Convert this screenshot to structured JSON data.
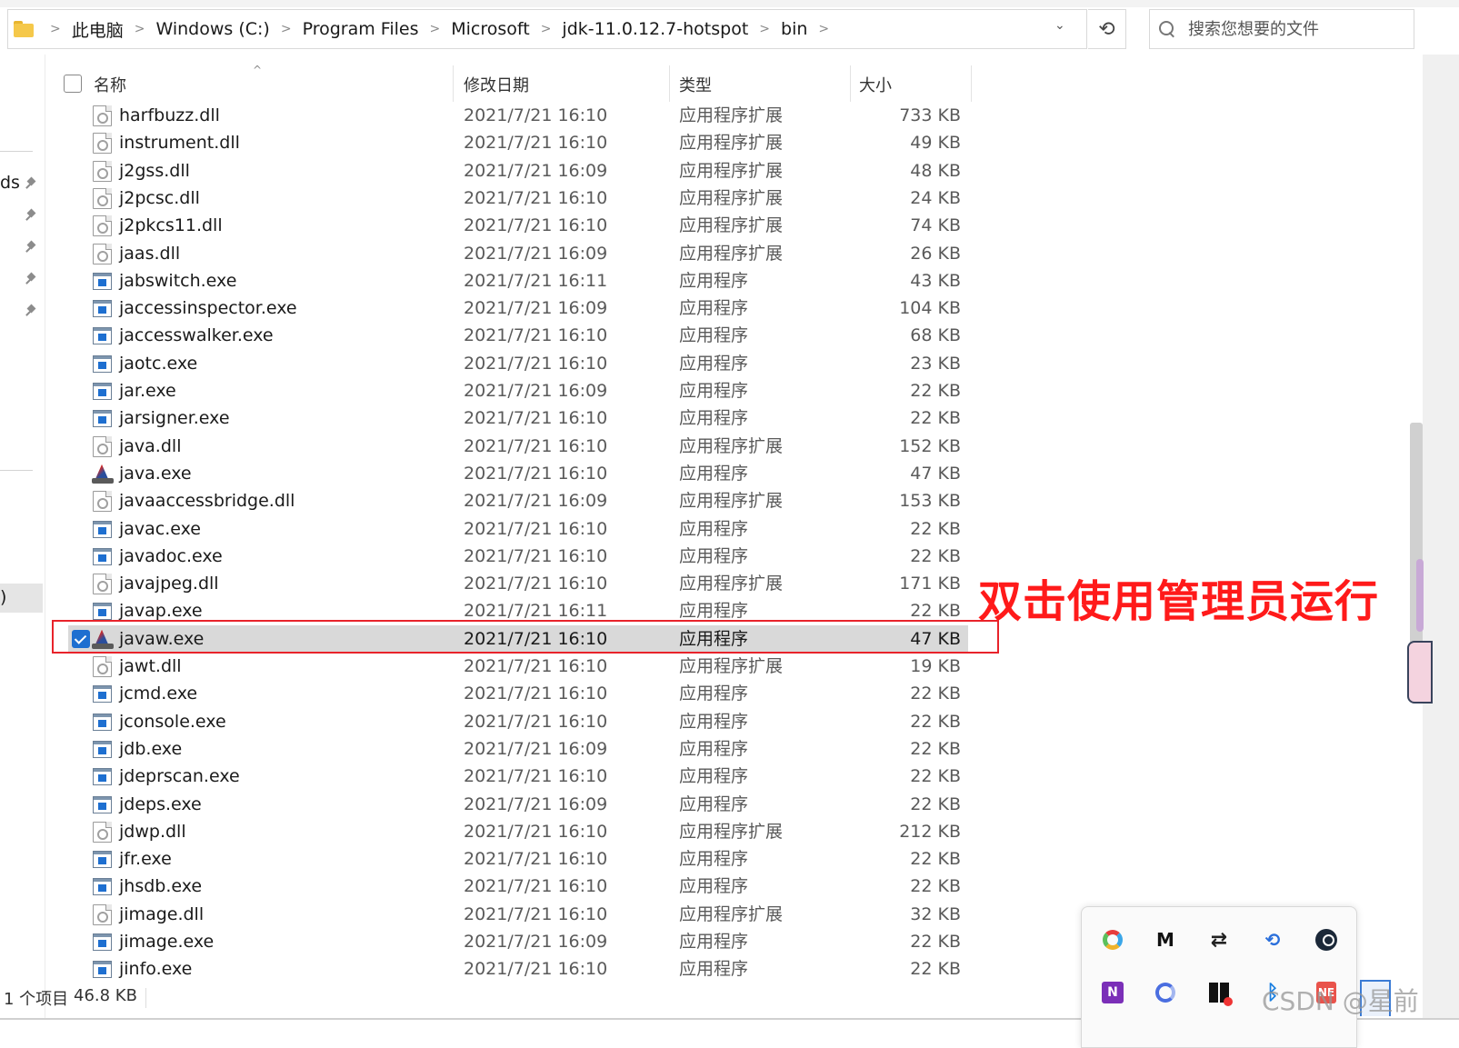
{
  "breadcrumb": [
    "此电脑",
    "Windows (C:)",
    "Program Files",
    "Microsoft",
    "jdk-11.0.12.7-hotspot",
    "bin"
  ],
  "search": {
    "placeholder": "搜索您想要的文件"
  },
  "nav": {
    "label_downloads_fragment": "ds",
    "label_selected_fragment": ")"
  },
  "columns": {
    "name": "名称",
    "date": "修改日期",
    "type": "类型",
    "size": "大小"
  },
  "files": [
    {
      "name": "harfbuzz.dll",
      "date": "2021/7/21 16:10",
      "type": "应用程序扩展",
      "size": "733 KB",
      "icon": "dll-file-icon"
    },
    {
      "name": "instrument.dll",
      "date": "2021/7/21 16:10",
      "type": "应用程序扩展",
      "size": "49 KB",
      "icon": "dll-file-icon"
    },
    {
      "name": "j2gss.dll",
      "date": "2021/7/21 16:09",
      "type": "应用程序扩展",
      "size": "48 KB",
      "icon": "dll-file-icon"
    },
    {
      "name": "j2pcsc.dll",
      "date": "2021/7/21 16:10",
      "type": "应用程序扩展",
      "size": "24 KB",
      "icon": "dll-file-icon"
    },
    {
      "name": "j2pkcs11.dll",
      "date": "2021/7/21 16:10",
      "type": "应用程序扩展",
      "size": "74 KB",
      "icon": "dll-file-icon"
    },
    {
      "name": "jaas.dll",
      "date": "2021/7/21 16:09",
      "type": "应用程序扩展",
      "size": "26 KB",
      "icon": "dll-file-icon"
    },
    {
      "name": "jabswitch.exe",
      "date": "2021/7/21 16:11",
      "type": "应用程序",
      "size": "43 KB",
      "icon": "exe-file-icon"
    },
    {
      "name": "jaccessinspector.exe",
      "date": "2021/7/21 16:09",
      "type": "应用程序",
      "size": "104 KB",
      "icon": "exe-file-icon"
    },
    {
      "name": "jaccesswalker.exe",
      "date": "2021/7/21 16:10",
      "type": "应用程序",
      "size": "68 KB",
      "icon": "exe-file-icon"
    },
    {
      "name": "jaotc.exe",
      "date": "2021/7/21 16:10",
      "type": "应用程序",
      "size": "23 KB",
      "icon": "exe-file-icon"
    },
    {
      "name": "jar.exe",
      "date": "2021/7/21 16:09",
      "type": "应用程序",
      "size": "22 KB",
      "icon": "exe-file-icon"
    },
    {
      "name": "jarsigner.exe",
      "date": "2021/7/21 16:10",
      "type": "应用程序",
      "size": "22 KB",
      "icon": "exe-file-icon"
    },
    {
      "name": "java.dll",
      "date": "2021/7/21 16:10",
      "type": "应用程序扩展",
      "size": "152 KB",
      "icon": "dll-file-icon"
    },
    {
      "name": "java.exe",
      "date": "2021/7/21 16:10",
      "type": "应用程序",
      "size": "47 KB",
      "icon": "java-file-icon"
    },
    {
      "name": "javaaccessbridge.dll",
      "date": "2021/7/21 16:09",
      "type": "应用程序扩展",
      "size": "153 KB",
      "icon": "dll-file-icon"
    },
    {
      "name": "javac.exe",
      "date": "2021/7/21 16:10",
      "type": "应用程序",
      "size": "22 KB",
      "icon": "exe-file-icon"
    },
    {
      "name": "javadoc.exe",
      "date": "2021/7/21 16:10",
      "type": "应用程序",
      "size": "22 KB",
      "icon": "exe-file-icon"
    },
    {
      "name": "javajpeg.dll",
      "date": "2021/7/21 16:10",
      "type": "应用程序扩展",
      "size": "171 KB",
      "icon": "dll-file-icon"
    },
    {
      "name": "javap.exe",
      "date": "2021/7/21 16:11",
      "type": "应用程序",
      "size": "22 KB",
      "icon": "exe-file-icon"
    },
    {
      "name": "javaw.exe",
      "date": "2021/7/21 16:10",
      "type": "应用程序",
      "size": "47 KB",
      "icon": "java-file-icon",
      "selected": true
    },
    {
      "name": "jawt.dll",
      "date": "2021/7/21 16:10",
      "type": "应用程序扩展",
      "size": "19 KB",
      "icon": "dll-file-icon"
    },
    {
      "name": "jcmd.exe",
      "date": "2021/7/21 16:10",
      "type": "应用程序",
      "size": "22 KB",
      "icon": "exe-file-icon"
    },
    {
      "name": "jconsole.exe",
      "date": "2021/7/21 16:10",
      "type": "应用程序",
      "size": "22 KB",
      "icon": "exe-file-icon"
    },
    {
      "name": "jdb.exe",
      "date": "2021/7/21 16:09",
      "type": "应用程序",
      "size": "22 KB",
      "icon": "exe-file-icon"
    },
    {
      "name": "jdeprscan.exe",
      "date": "2021/7/21 16:10",
      "type": "应用程序",
      "size": "22 KB",
      "icon": "exe-file-icon"
    },
    {
      "name": "jdeps.exe",
      "date": "2021/7/21 16:09",
      "type": "应用程序",
      "size": "22 KB",
      "icon": "exe-file-icon"
    },
    {
      "name": "jdwp.dll",
      "date": "2021/7/21 16:10",
      "type": "应用程序扩展",
      "size": "212 KB",
      "icon": "dll-file-icon"
    },
    {
      "name": "jfr.exe",
      "date": "2021/7/21 16:10",
      "type": "应用程序",
      "size": "22 KB",
      "icon": "exe-file-icon"
    },
    {
      "name": "jhsdb.exe",
      "date": "2021/7/21 16:10",
      "type": "应用程序",
      "size": "22 KB",
      "icon": "exe-file-icon"
    },
    {
      "name": "jimage.dll",
      "date": "2021/7/21 16:10",
      "type": "应用程序扩展",
      "size": "32 KB",
      "icon": "dll-file-icon"
    },
    {
      "name": "jimage.exe",
      "date": "2021/7/21 16:09",
      "type": "应用程序",
      "size": "22 KB",
      "icon": "exe-file-icon"
    },
    {
      "name": "jinfo.exe",
      "date": "2021/7/21 16:10",
      "type": "应用程序",
      "size": "22 KB",
      "icon": "exe-file-icon"
    }
  ],
  "annotation": "双击使用管理员运行",
  "status": {
    "count": "1 个项目",
    "size": "46.8 KB"
  },
  "watermark": "CSDN @星前",
  "tray": {
    "icons": [
      "color-wheel-icon",
      "media-icon",
      "settings-sliders-icon",
      "sync-icon",
      "steam-icon",
      "onenote-icon",
      "ring-icon",
      "app-grid-icon",
      "bluetooth-icon",
      "netease-icon"
    ],
    "glyphs": {
      "media": "Ⅿ",
      "sliders": "⇄",
      "sync": "⟲",
      "onenote": "N",
      "netease": "NE",
      "bluetooth": "ᛒ"
    }
  },
  "colors": {
    "selection": "#d9d9d9",
    "accent": "#1e6fd0",
    "annotation": "#ff1a1a",
    "highlight_border": "#e8232b"
  }
}
